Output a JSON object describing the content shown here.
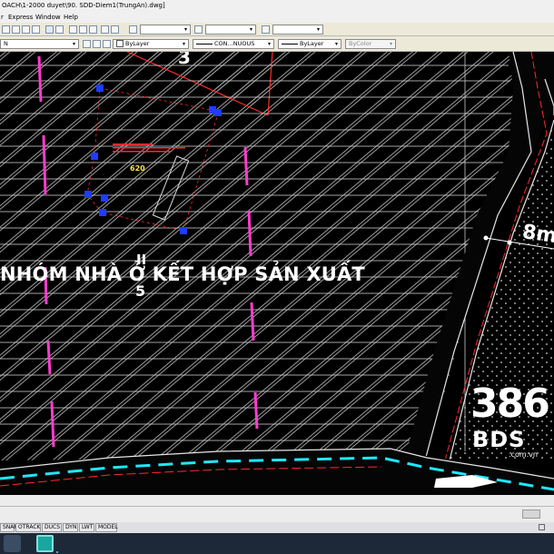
{
  "window": {
    "title": "OACH\\1-2000 duyet\\90. SDD-Diem1(TrungAn).dwg]"
  },
  "menu": {
    "items": [
      "r",
      "Express",
      "Window",
      "Help"
    ]
  },
  "toolbar2": {
    "layer_value": "N",
    "color_value": "ByLayer",
    "linetype_value": "CON...NUOUS",
    "lineweight_value": "ByLayer",
    "plotstyle_value": "ByColor"
  },
  "drawing": {
    "lot_number_top": "3",
    "area_value": "620",
    "zone_label": "NHÓM NHÀ Ở KẾT HỢP SẢN XUẤT",
    "zone_code_top": "II",
    "zone_code_bottom": "5",
    "road_width": "8m",
    "colors": {
      "pink": "#ff3ccf",
      "cyan": "#1fe8ff",
      "blue": "#1f3cff",
      "yellow": "#ffe24a",
      "red": "#ff2a2a"
    }
  },
  "status": {
    "buttons": [
      "SNAP",
      "OTRACK",
      "DUCS",
      "DYN",
      "LWT",
      "MODEL"
    ]
  },
  "watermark": {
    "number": "386",
    "brand": "BDS",
    "domain": ".com.vn"
  }
}
